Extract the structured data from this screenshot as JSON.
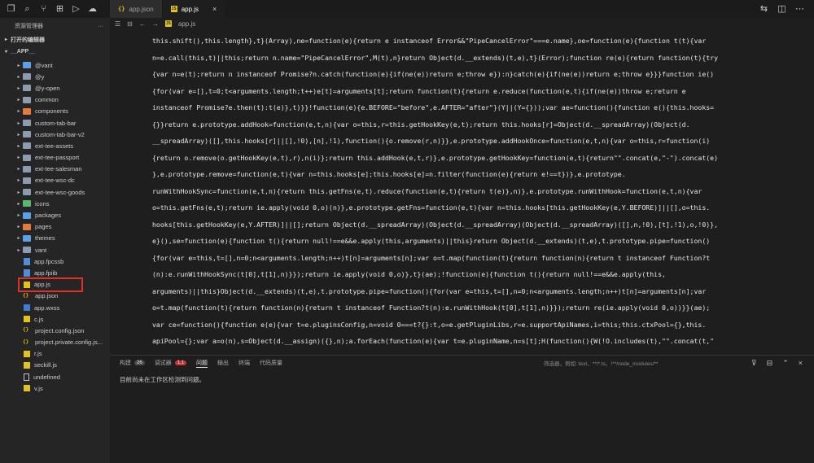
{
  "titlebar": {
    "left_icons": [
      "files-icon",
      "search-icon",
      "source-control-icon",
      "extensions-icon",
      "debug-icon",
      "cloud-icon"
    ],
    "tabs": [
      {
        "label": "app.json",
        "kind": "json",
        "active": false
      },
      {
        "label": "app.js",
        "kind": "js",
        "active": true
      }
    ],
    "close_glyph": "×",
    "right_icons": [
      "split-editor-icon",
      "layout-icon",
      "more-icon"
    ]
  },
  "breadcrumb": {
    "file": "app.js"
  },
  "sidebar": {
    "title": "资源管理器",
    "more": "···",
    "open_editors": "打开的编辑器",
    "root": "__APP__",
    "items": [
      {
        "label": "@vant",
        "icon": "folder-blue",
        "chev": true
      },
      {
        "label": "@y",
        "icon": "folder",
        "chev": true
      },
      {
        "label": "@y-open",
        "icon": "folder",
        "chev": true
      },
      {
        "label": "common",
        "icon": "folder",
        "chev": true
      },
      {
        "label": "components",
        "icon": "folder-orange",
        "chev": true
      },
      {
        "label": "custom-tab-bar",
        "icon": "folder",
        "chev": true
      },
      {
        "label": "custom-tab-bar-v2",
        "icon": "folder",
        "chev": true
      },
      {
        "label": "ext-tee-assets",
        "icon": "folder",
        "chev": true
      },
      {
        "label": "ext-tee-passport",
        "icon": "folder",
        "chev": true
      },
      {
        "label": "ext-tee-salesman",
        "icon": "folder",
        "chev": true
      },
      {
        "label": "ext-tee-wsc-dc",
        "icon": "folder",
        "chev": true
      },
      {
        "label": "ext-tee-wsc-goods",
        "icon": "folder",
        "chev": true
      },
      {
        "label": "icons",
        "icon": "folder-green",
        "chev": true
      },
      {
        "label": "packages",
        "icon": "folder-blue",
        "chev": true
      },
      {
        "label": "pages",
        "icon": "folder-orange",
        "chev": true
      },
      {
        "label": "themes",
        "icon": "folder-blue",
        "chev": true
      },
      {
        "label": "vant",
        "icon": "folder",
        "chev": true
      },
      {
        "label": "app.fpcssb",
        "icon": "file-blue",
        "chev": false
      },
      {
        "label": "app.fpiib",
        "icon": "file-blue",
        "chev": false
      },
      {
        "label": "app.js",
        "icon": "file-js",
        "chev": false
      },
      {
        "label": "app.json",
        "icon": "file-json",
        "chev": false
      },
      {
        "label": "app.wxss",
        "icon": "file-wxss",
        "chev": false
      },
      {
        "label": "c.js",
        "icon": "file-js",
        "chev": false
      },
      {
        "label": "project.config.json",
        "icon": "file-json",
        "chev": false
      },
      {
        "label": "project.private.config.js...",
        "icon": "file-json",
        "chev": false
      },
      {
        "label": "r.js",
        "icon": "file-js",
        "chev": false
      },
      {
        "label": "seckill.js",
        "icon": "file-js",
        "chev": false
      },
      {
        "label": "undefined",
        "icon": "file-plain",
        "chev": false
      },
      {
        "label": "v.js",
        "icon": "file-js",
        "chev": false
      }
    ]
  },
  "code_lines": [
    "this.shift(),this.length},t}(Array),ne=function(e){return e instanceof Error&&\"PipeCancelError\"===e.name},oe=function(e){function t(t){var",
    "n=e.call(this,t)||this;return n.name=\"PipeCancelError\",M(t),n}return Object(d.__extends)(t,e),t}(Error);function re(e){return function(t){try",
    "{var n=e(t);return n instanceof Promise?n.catch(function(e){if(ne(e))return e;throw e}):n}catch(e){if(ne(e))return e;throw e}}}function ie()",
    "{for(var e=[],t=0;t<arguments.length;t++)e[t]=arguments[t];return function(t){return e.reduce(function(e,t){if(ne(e))throw e;return e",
    "instanceof Promise?e.then(t):t(e)},t)}}!function(e){e.BEFORE=\"before\",e.AFTER=\"after\"}(Y||(Y={}));var ae=function(){function e(){this.hooks=",
    "{}}return e.prototype.addHook=function(e,t,n){var o=this,r=this.getHookKey(e,t);return this.hooks[r]=Object(d.__spreadArray)(Object(d.",
    "__spreadArray)([],this.hooks[r]||[],!0),[n],!1),function(){o.remove(r,n)}},e.prototype.addHookOnce=function(e,t,n){var o=this,r=function(i)",
    "{return o.remove(o.getHookKey(e,t),r),n(i)};return this.addHook(e,t,r)},e.prototype.getHookKey=function(e,t){return\"\".concat(e,\"-\").concat(e)",
    "},e.prototype.remove=function(e,t){var n=this.hooks[e];this.hooks[e]=n.filter(function(e){return e!==t})},e.prototype.",
    "runWithHookSync=function(e,t,n){return this.getFns(e,t).reduce(function(e,t){return t(e)},n)},e.prototype.runWithHook=function(e,t,n){var",
    "o=this.getFns(e,t);return ie.apply(void 0,o)(n)},e.prototype.getFns=function(e,t){var n=this.hooks[this.getHookKey(e,Y.BEFORE)]||[],o=this.",
    "hooks[this.getHookKey(e,Y.AFTER)]||[];return Object(d.__spreadArray)(Object(d.__spreadArray)(Object(d.__spreadArray)([],n,!0),[t],!1),o,!0)},",
    "e}(),se=function(e){function t(){return null!==e&&e.apply(this,arguments)||this}return Object(d.__extends)(t,e),t.prototype.pipe=function()",
    "{for(var e=this,t=[],n=0;n<arguments.length;n++)t[n]=arguments[n];var o=t.map(function(t){return function(n){return t instanceof Function?t",
    "(n):e.runWithHookSync(t[0],t[1],n)}});return ie.apply(void 0,o)},t}(ae);!function(e){function t(){return null!==e&&e.apply(this,",
    "arguments)||this}Object(d.__extends)(t,e),t.prototype.pipe=function(){for(var e=this,t=[],n=0;n<arguments.length;n++)t[n]=arguments[n];var",
    "o=t.map(function(t){return function(n){return t instanceof Function?t(n):e.runWithHook(t[0],t[1],n)}});return re(ie.apply(void 0,o))}}(ae);",
    "var ce=function(){function e(e){var t=e.pluginsConfig,n=void 0===t?{}:t,o=e.getPluginLibs,r=e.supportApiNames,i=this;this.ctxPool={},this.",
    "apiPool={};var a=o(n),s=Object(d.__assign)({},n);a.forEach(function(e){var t=e.pluginName,n=s[t];H(function(){W(!O.includes(t),\"\".concat(t,\""
  ],
  "panel": {
    "tabs": [
      {
        "label": "构建",
        "count": "26",
        "red": false,
        "active": false
      },
      {
        "label": "调试器",
        "count": "1,1",
        "red": true,
        "active": false
      },
      {
        "label": "问题",
        "count": "",
        "red": false,
        "active": true
      },
      {
        "label": "输出",
        "count": "",
        "red": false,
        "active": false
      },
      {
        "label": "终端",
        "count": "",
        "red": false,
        "active": false
      },
      {
        "label": "代码质量",
        "count": "",
        "red": false,
        "active": false
      }
    ],
    "filter_placeholder": "筛选器，例如: text、**/*.ts、!**/node_modules/**",
    "icons": [
      "filter-icon",
      "collapse-all-icon",
      "chevron-up-icon",
      "close-icon"
    ],
    "message": "目前尚未在工作区检测到问题。"
  }
}
